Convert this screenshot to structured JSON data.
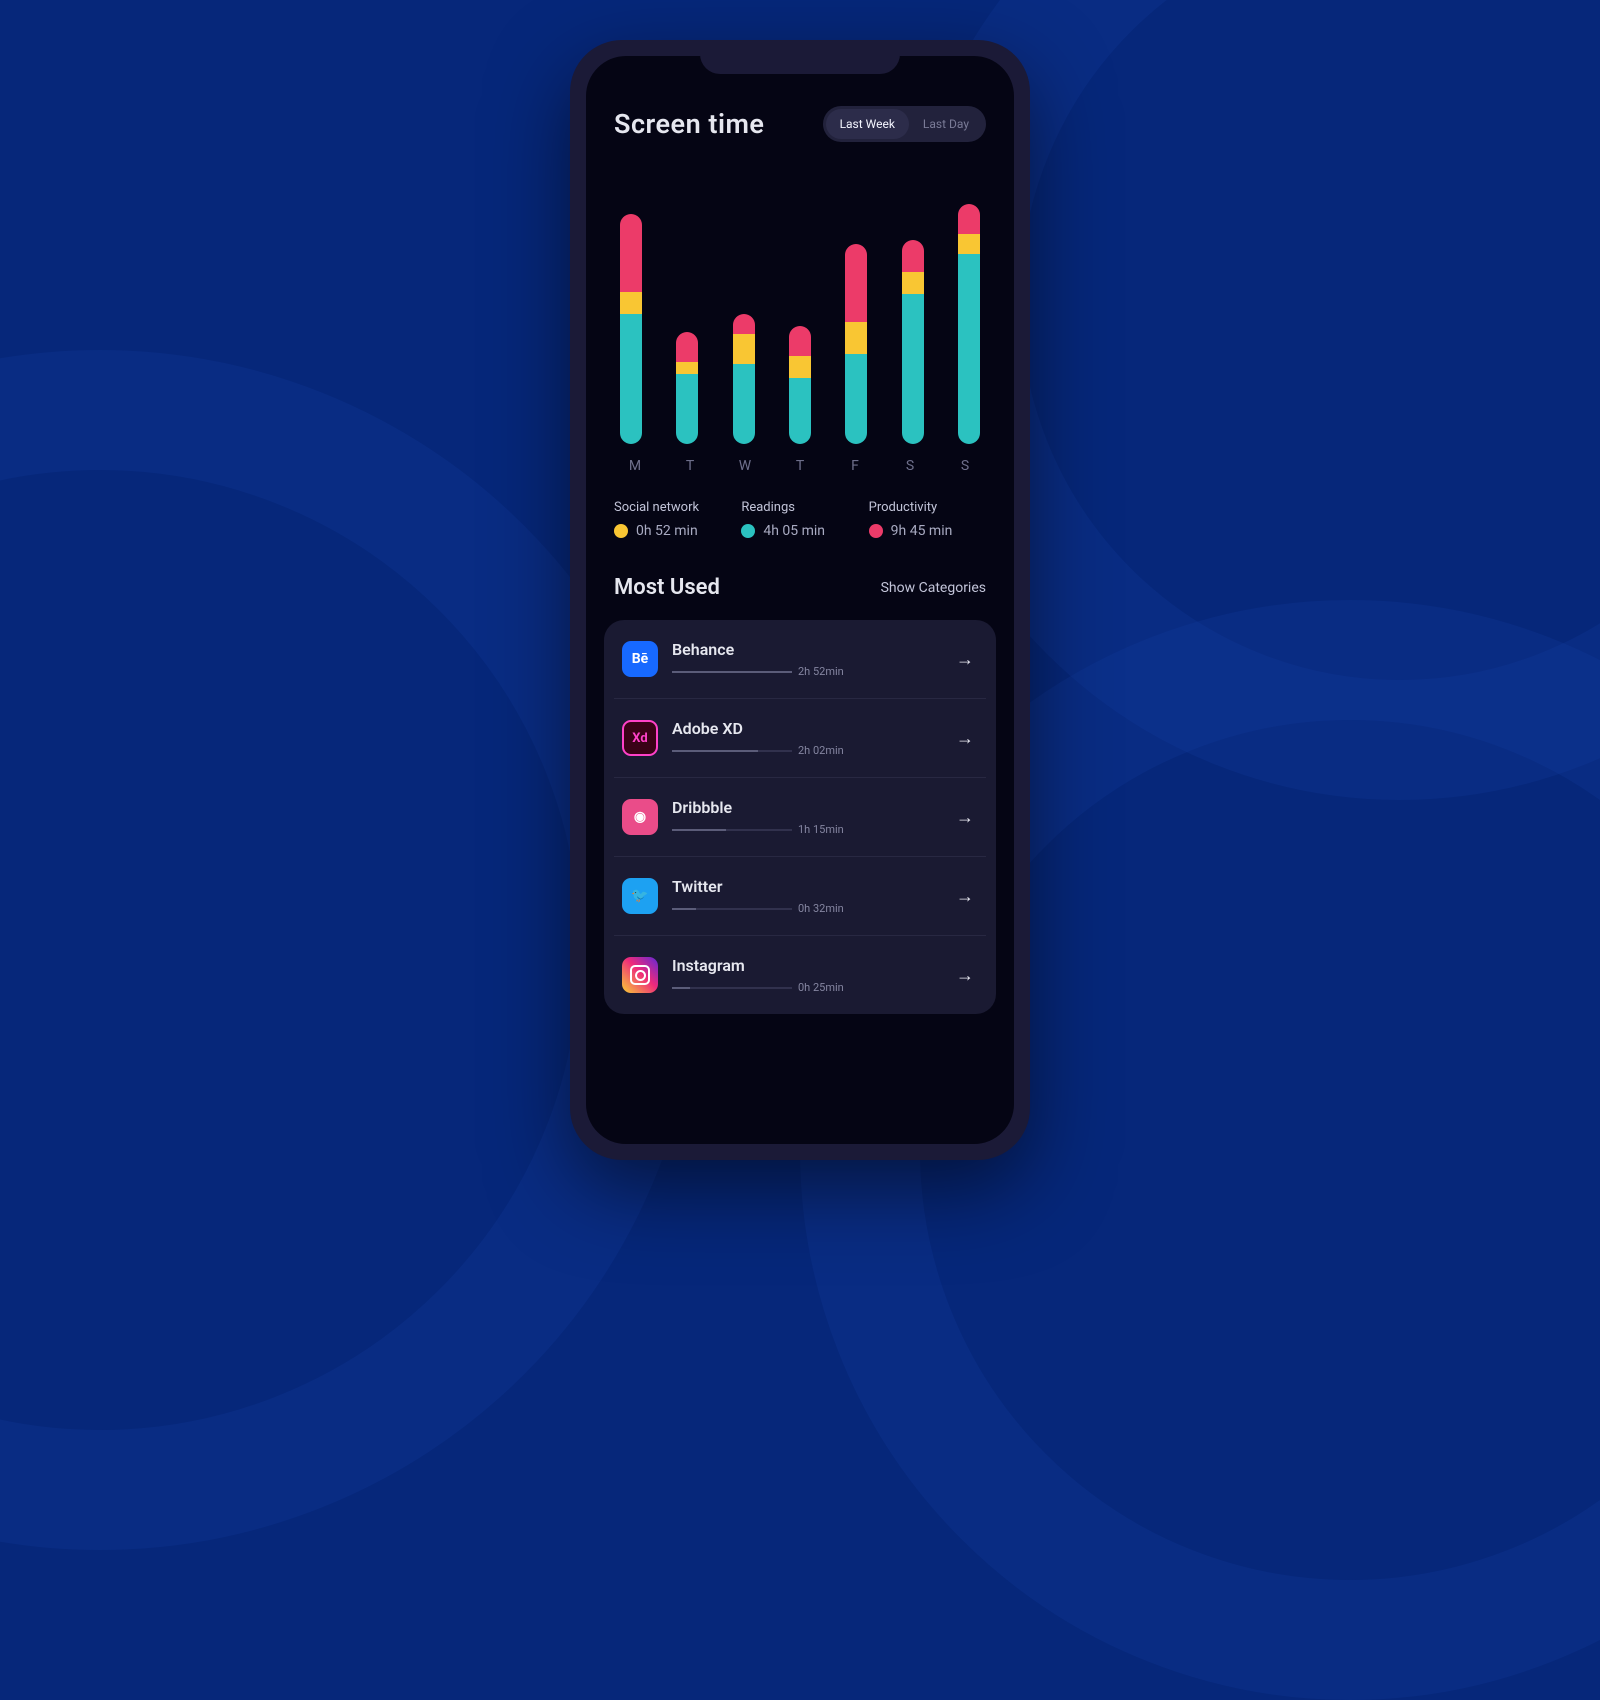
{
  "header": {
    "title": "Screen time",
    "segmented": {
      "active": "Last Week",
      "inactive": "Last Day"
    }
  },
  "chart_data": {
    "type": "bar",
    "stacked": true,
    "categories": [
      "M",
      "T",
      "W",
      "T",
      "F",
      "S",
      "S"
    ],
    "series": [
      {
        "name": "Productivity",
        "color": "#ec3b69",
        "values": [
          78,
          30,
          20,
          30,
          78,
          32,
          30
        ]
      },
      {
        "name": "Social network",
        "color": "#f9c633",
        "values": [
          22,
          12,
          30,
          22,
          32,
          22,
          20
        ]
      },
      {
        "name": "Readings",
        "color": "#2bc2c0",
        "values": [
          130,
          70,
          80,
          66,
          90,
          150,
          190
        ]
      }
    ],
    "title": "Screen time",
    "ylim": [
      0,
      260
    ]
  },
  "legend": [
    {
      "name": "Social network",
      "value": "0h 52 min",
      "color": "yellow"
    },
    {
      "name": "Readings",
      "value": "4h 05 min",
      "color": "teal"
    },
    {
      "name": "Productivity",
      "value": "9h 45 min",
      "color": "pink"
    }
  ],
  "most_used": {
    "title": "Most Used",
    "link": "Show Categories",
    "apps": [
      {
        "name": "Behance",
        "time": "2h 52min",
        "progress": 100,
        "icon": "behance",
        "glyph": "Bē"
      },
      {
        "name": "Adobe XD",
        "time": "2h 02min",
        "progress": 72,
        "icon": "xd",
        "glyph": "Xd"
      },
      {
        "name": "Dribbble",
        "time": "1h 15min",
        "progress": 45,
        "icon": "dribbble",
        "glyph": "◉"
      },
      {
        "name": "Twitter",
        "time": "0h 32min",
        "progress": 20,
        "icon": "twitter",
        "glyph": "🐦"
      },
      {
        "name": "Instagram",
        "time": "0h 25min",
        "progress": 15,
        "icon": "instagram",
        "glyph": ""
      }
    ]
  }
}
